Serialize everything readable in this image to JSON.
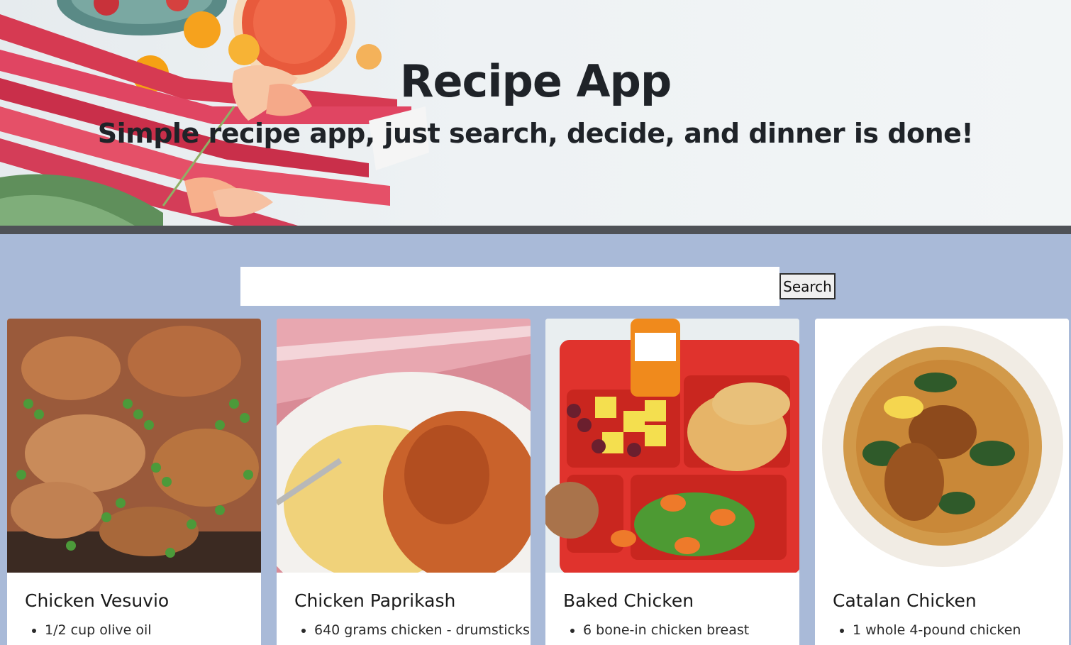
{
  "header": {
    "title": "Recipe App",
    "subtitle": "Simple recipe app, just search, decide, and dinner is done!"
  },
  "search": {
    "value": "",
    "placeholder": "",
    "button_label": "Search"
  },
  "recipes": [
    {
      "title": "Chicken Vesuvio",
      "first_ingredient": "1/2 cup olive oil",
      "image": "chicken-vesuvio-photo"
    },
    {
      "title": "Chicken Paprikash",
      "first_ingredient": "640 grams chicken - drumsticks",
      "image": "chicken-paprikash-photo"
    },
    {
      "title": "Baked Chicken",
      "first_ingredient": "6 bone-in chicken breast",
      "image": "baked-chicken-tray-photo"
    },
    {
      "title": "Catalan Chicken",
      "first_ingredient": "1 whole 4-pound chicken",
      "image": "catalan-chicken-bowl-photo"
    }
  ],
  "colors": {
    "page_background": "#a9bad8",
    "hero_divider": "#4f5257",
    "title_text": "#1f2328"
  }
}
